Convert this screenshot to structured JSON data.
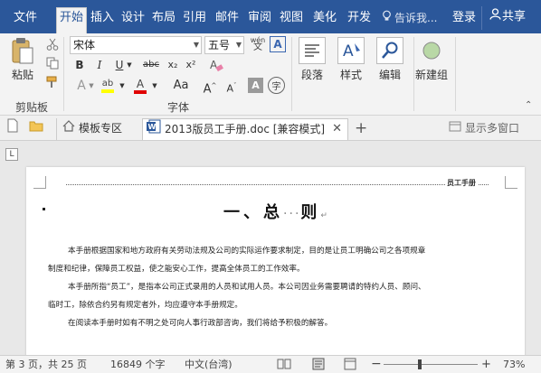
{
  "tabs": [
    {
      "label": "文件",
      "active": false
    },
    {
      "label": "开始",
      "active": true
    },
    {
      "label": "插入",
      "active": false
    },
    {
      "label": "设计",
      "active": false
    },
    {
      "label": "布局",
      "active": false
    },
    {
      "label": "引用",
      "active": false
    },
    {
      "label": "邮件",
      "active": false
    },
    {
      "label": "审阅",
      "active": false
    },
    {
      "label": "视图",
      "active": false
    },
    {
      "label": "美化",
      "active": false
    },
    {
      "label": "开发",
      "active": false
    }
  ],
  "tell_me": "告诉我...",
  "login": "登录",
  "share": "共享",
  "ribbon": {
    "clipboard": {
      "paste": "粘贴",
      "label": "剪贴板"
    },
    "font": {
      "name": "宋体",
      "size": "五号",
      "phonetic": "wén",
      "label": "字体"
    },
    "paragraph": {
      "label": "段落"
    },
    "styles": {
      "label": "样式"
    },
    "editing": {
      "label": "编辑"
    },
    "new_group": {
      "label": "新建组"
    }
  },
  "doc_tabs": {
    "template_zone": "模板专区",
    "document": "2013版员工手册.doc [兼容模式]",
    "multi_window": "显示多窗口"
  },
  "ruler_mark": "L",
  "document": {
    "header_text": "员工手册",
    "chapter_left": "一、总",
    "chapter_dots": "···",
    "chapter_right": "则",
    "para_mark": "↵",
    "paragraphs": [
      "本手册根据国家和地方政府有关劳动法规及公司的实际运作要求制定，目的是让员工明确公司之各项规章",
      "制度和纪律，保障员工权益，使之能安心工作，提高全体员工的工作效率。",
      "本手册所指“员工”，是指本公司正式录用的人员和试用人员。本公司因业务需要聘请的特约人员、顾问、",
      "临时工，除依合约另有规定者外，均应遵守本手册规定。",
      "在阅读本手册时如有不明之处可向人事行政部咨询，我们将给予积极的解答。"
    ]
  },
  "status": {
    "page": "第 3 页，共 25 页",
    "words": "16849 个字",
    "language": "中文(台湾)",
    "zoom": "73%",
    "minus": "−",
    "plus": "+"
  },
  "colors": {
    "accent": "#2b579a",
    "highlight": "#ffff00",
    "font_red": "#e00000"
  }
}
